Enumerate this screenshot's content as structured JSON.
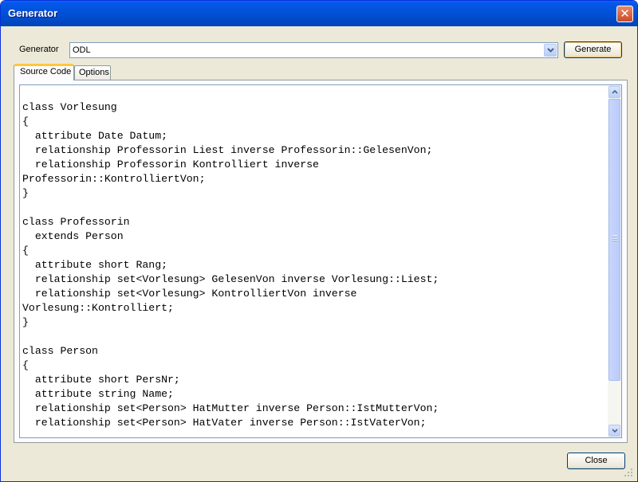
{
  "window": {
    "title": "Generator",
    "close_glyph": "✕"
  },
  "generator": {
    "label": "Generator",
    "selected": "ODL",
    "generate_label": "Generate"
  },
  "tabs": [
    {
      "label": "Source Code",
      "active": true
    },
    {
      "label": "Options",
      "active": false
    }
  ],
  "source_code": "class Vorlesung\n{\n  attribute Date Datum;\n  relationship Professorin Liest inverse Professorin::GelesenVon;\n  relationship Professorin Kontrolliert inverse\nProfessorin::KontrolliertVon;\n}\n\nclass Professorin\n  extends Person\n{\n  attribute short Rang;\n  relationship set<Vorlesung> GelesenVon inverse Vorlesung::Liest;\n  relationship set<Vorlesung> KontrolliertVon inverse\nVorlesung::Kontrolliert;\n}\n\nclass Person\n{\n  attribute short PersNr;\n  attribute string Name;\n  relationship set<Person> HatMutter inverse Person::IstMutterVon;\n  relationship set<Person> HatVater inverse Person::IstVaterVon;",
  "footer": {
    "close_label": "Close"
  },
  "icons": {
    "window_close": "close-icon",
    "combo_dropdown": "chevron-down-icon",
    "scroll_up": "arrow-up-icon",
    "scroll_down": "arrow-down-icon",
    "resize": "size-grip-icon"
  },
  "colors": {
    "titlebar": "#0152d8",
    "accent_tab": "#ffc73c",
    "dialog_bg": "#ece9d8",
    "border": "#7f9db9"
  }
}
